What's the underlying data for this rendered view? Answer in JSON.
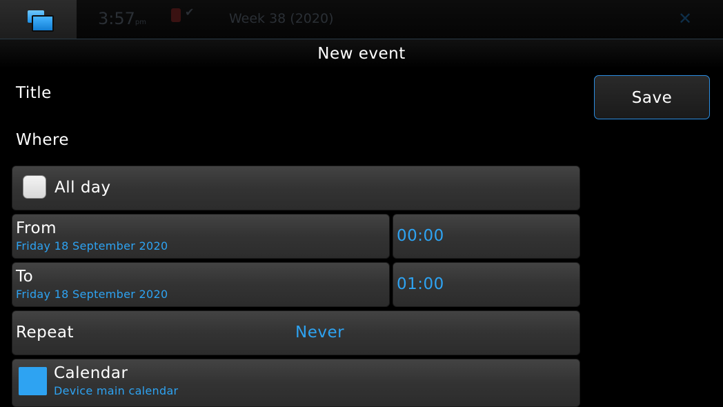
{
  "status_bar": {
    "time": "3:57",
    "ampm": "pm",
    "week": "Week 38 (2020)"
  },
  "title": "New event",
  "form": {
    "title_label": "Title",
    "where_label": "Where",
    "all_day": {
      "label": "All day",
      "checked": false
    },
    "from": {
      "label": "From",
      "date": "Friday 18 September 2020",
      "time": "00:00"
    },
    "to": {
      "label": "To",
      "date": "Friday 18 September 2020",
      "time": "01:00"
    },
    "repeat": {
      "label": "Repeat",
      "value": "Never"
    },
    "calendar": {
      "label": "Calendar",
      "value": "Device main calendar",
      "color": "#2ea3f2"
    }
  },
  "actions": {
    "save_label": "Save"
  },
  "colors": {
    "accent": "#2ea3f2",
    "row_bg": "#3a3a3a",
    "save_border": "#2c8ee2"
  }
}
